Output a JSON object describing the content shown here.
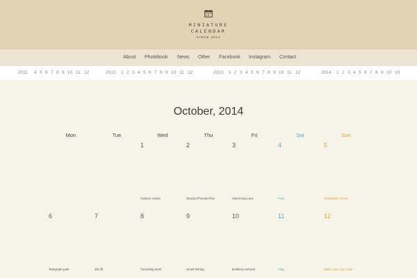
{
  "brand": {
    "line1": "MINIATURE",
    "line2": "CALENDAR",
    "since": "SINCE 2011",
    "icon": "calendar-icon"
  },
  "nav": [
    "About",
    "Photobook",
    "News",
    "Other",
    "Facebook",
    "Instagram",
    "Contact"
  ],
  "years": {
    "y2011": "2011",
    "y2012": "2012",
    "y2013": "2013",
    "y2014": "2014",
    "months": [
      "1",
      "2",
      "3",
      "4",
      "5",
      "6",
      "7",
      "8",
      "9",
      "10",
      "11",
      "12"
    ]
  },
  "calendar": {
    "title": "October, 2014",
    "days_of_week": [
      "Mon",
      "Tue",
      "Wed",
      "Thu",
      "Fri",
      "Sat",
      "Sun"
    ],
    "week1": [
      {
        "day": "1",
        "event": "Autumn colors"
      },
      {
        "day": "2",
        "event": "Sturdy iPhone6 Plus"
      },
      {
        "day": "3",
        "event": "Swimming race"
      },
      {
        "day": "4",
        "event": "Polo"
      },
      {
        "day": "5",
        "event": "Toothpaste Snow"
      }
    ],
    "week2": [
      {
        "day": "6",
        "event": "Telegraph pole"
      },
      {
        "day": "7",
        "event": "Ski lift"
      },
      {
        "day": "8",
        "event": "Tunneling work"
      },
      {
        "day": "9",
        "event": "Smelt fishing"
      },
      {
        "day": "10",
        "event": "Endless summer"
      },
      {
        "day": "11",
        "event": "Flag"
      },
      {
        "day": "12",
        "event": "Make your own road"
      }
    ]
  },
  "colors": {
    "header": "#e2d3b4",
    "nav": "#ece4d1",
    "background": "#f6f3e9",
    "saturday": "#5aabbd",
    "sunday": "#e0a22a"
  }
}
